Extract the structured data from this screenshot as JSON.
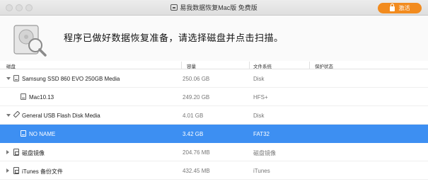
{
  "window": {
    "title": "易我数据恢复Mac版 免费版",
    "activate_label": "激活"
  },
  "header": {
    "message": "程序已做好数据恢复准备，请选择磁盘并点击扫描。"
  },
  "columns": {
    "disk": "磁盘",
    "capacity": "容量",
    "filesystem": "文件系统",
    "protection": "保护状态"
  },
  "rows": [
    {
      "name": "Samsung SSD 860 EVO 250GB Media",
      "capacity": "250.06 GB",
      "filesystem": "Disk",
      "level": 0,
      "expanded": true,
      "icon": "disk-icon"
    },
    {
      "name": "Mac10.13",
      "capacity": "249.20 GB",
      "filesystem": "HFS+",
      "level": 1,
      "icon": "disk-icon"
    },
    {
      "name": "General USB Flash Disk Media",
      "capacity": "4.01 GB",
      "filesystem": "Disk",
      "level": 0,
      "expanded": true,
      "icon": "usb-icon"
    },
    {
      "name": "NO NAME",
      "capacity": "3.42 GB",
      "filesystem": "FAT32",
      "level": 1,
      "selected": true,
      "icon": "disk-icon"
    },
    {
      "name": "磁盘镜像",
      "capacity": "204.76 MB",
      "filesystem": "磁盘镜像",
      "level": 0,
      "expanded": false,
      "icon": "image-icon"
    },
    {
      "name": "iTunes 备份文件",
      "capacity": "432.45 MB",
      "filesystem": "iTunes",
      "level": 0,
      "expanded": false,
      "icon": "backup-icon"
    }
  ],
  "colors": {
    "accent": "#f28b1e",
    "selection": "#3d8ff2"
  }
}
